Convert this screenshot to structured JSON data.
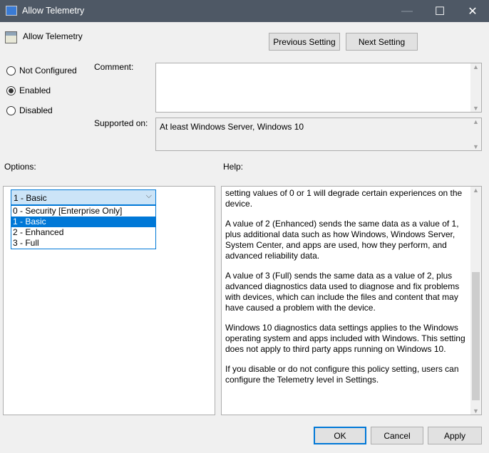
{
  "window": {
    "title": "Allow Telemetry",
    "minimize": "—",
    "maximize": "☐",
    "close": "✕"
  },
  "header": {
    "title": "Allow Telemetry",
    "prev_button": "Previous Setting",
    "next_button": "Next Setting"
  },
  "radios": [
    {
      "label": "Not Configured",
      "checked": false
    },
    {
      "label": "Enabled",
      "checked": true
    },
    {
      "label": "Disabled",
      "checked": false
    }
  ],
  "comment": {
    "label": "Comment:",
    "value": ""
  },
  "supported": {
    "label": "Supported on:",
    "value": "At least Windows Server, Windows 10"
  },
  "options": {
    "label": "Options:",
    "selected": "1 - Basic",
    "items": [
      "0 - Security [Enterprise Only]",
      "1 - Basic",
      "2 - Enhanced",
      "3 - Full"
    ]
  },
  "help": {
    "label": "Help:",
    "paragraphs": [
      "setting values of 0 or 1 will degrade certain experiences on the device.",
      "A value of 2 (Enhanced) sends the same data as a value of 1, plus additional data such as how Windows, Windows Server, System Center, and apps are used, how they perform, and advanced reliability data.",
      "A value of 3 (Full) sends the same data as a value of 2, plus advanced diagnostics data used to diagnose and fix problems with devices, which can include the files and content that may have caused a problem with the device.",
      "Windows 10 diagnostics data settings applies to the Windows operating system and apps included with Windows. This setting does not apply to third party apps running on Windows 10.",
      "If you disable or do not configure this policy setting, users can configure the Telemetry level in Settings."
    ]
  },
  "footer": {
    "ok": "OK",
    "cancel": "Cancel",
    "apply": "Apply"
  },
  "colors": {
    "titlebar": "#4e5865",
    "selection": "#0078d7"
  }
}
